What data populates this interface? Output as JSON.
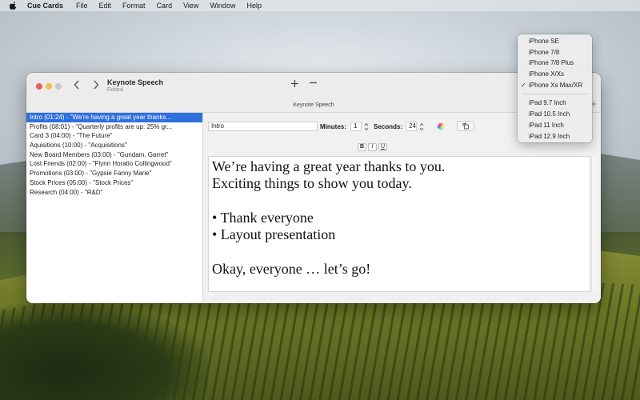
{
  "menubar": {
    "app_name": "Cue Cards",
    "items": [
      "File",
      "Edit",
      "Format",
      "Card",
      "View",
      "Window",
      "Help"
    ]
  },
  "window": {
    "title": "Keynote Speech",
    "subtitle": "Edited",
    "tab_label": "Keynote Speech"
  },
  "sidebar": {
    "items": [
      "Intro (01:24) - \"We're having a great year thanks...",
      "Profits (08:01) - \"Quarterly profits are up: 25% gr...",
      "Card 3 (04:00) - \"The Future\"",
      "Aquisitions (10:00) - \"Acquisitions\"",
      "New Board Members (03:00) - \"Gundam, Garret\"",
      "Lost Friends (02:00) - \"Flynn Horatio Collingwood\"",
      "Promotions (03:00) - \"Gypsie Fanny Marie\"",
      "Stock Prices (05:00) - \"Stock Prices\"",
      "Research (04:00) - \"R&D\""
    ],
    "selected_index": 0
  },
  "editor": {
    "card_name": "Intro",
    "minutes_label": "Minutes:",
    "minutes_value": "1",
    "seconds_label": "Seconds:",
    "seconds_value": "24",
    "format_bold": "B",
    "format_italic": "I",
    "format_underline": "U",
    "text_lines": [
      "We’re having a great year thanks to you.",
      "Exciting things to show you today.",
      "",
      "• Thank everyone",
      "• Layout presentation",
      "",
      "Okay, everyone … let’s go!"
    ]
  },
  "device_menu": {
    "phones": [
      "iPhone SE",
      "iPhone 7/8",
      "iPhone 7/8 Plus",
      "iPhone X/Xs",
      "iPhone Xs Max/XR"
    ],
    "tablets": [
      "iPad 9.7 Inch",
      "iPad 10.5 Inch",
      "iPad 11 Inch",
      "iPad 12.9 Inch"
    ],
    "checked": "iPhone Xs Max/XR",
    "check_mark": "✓"
  }
}
